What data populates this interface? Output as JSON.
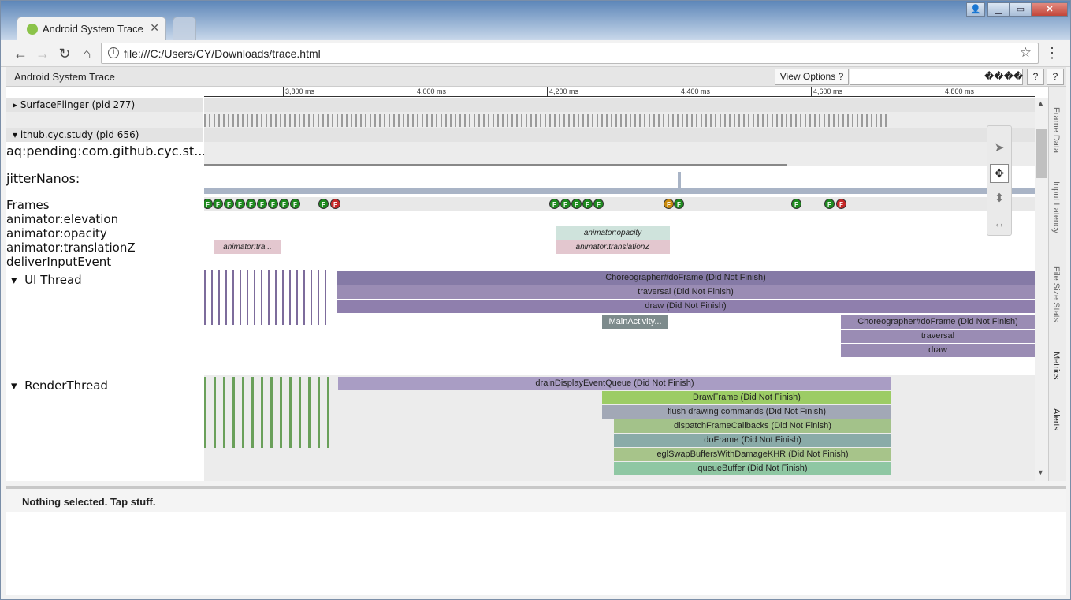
{
  "browser": {
    "tab_title": "Android System Trace",
    "url": "file:///C:/Users/CY/Downloads/trace.html"
  },
  "toolbar": {
    "title": "Android System Trace",
    "view_options": "View Options ?",
    "search_buttons": "����",
    "help_1": "?",
    "help_2": "?"
  },
  "ruler": {
    "ticks": [
      "3,800 ms",
      "4,000 ms",
      "4,200 ms",
      "4,400 ms",
      "4,600 ms",
      "4,800 ms"
    ]
  },
  "processes": {
    "surfaceflinger": "SurfaceFlinger (pid 277)",
    "app": "ithub.cyc.study (pid 656)"
  },
  "tracks": {
    "aq_pending": "aq:pending:com.github.cyc.st...",
    "jitter": "jitterNanos:",
    "frames": "Frames",
    "elevation": "animator:elevation",
    "opacity": "animator:opacity",
    "translationZ": "animator:translationZ",
    "input": "deliverInputEvent",
    "ui_thread": "UI Thread",
    "render_thread": "RenderThread"
  },
  "slices": {
    "anim_opacity": "animator:opacity",
    "anim_tra": "animator:tra...",
    "anim_translationZ": "animator:translationZ",
    "choreo": "Choreographer#doFrame (Did Not Finish)",
    "traversal": "traversal (Did Not Finish)",
    "draw": "draw (Did Not Finish)",
    "mainactivity": "MainActivity...",
    "choreo2": "Choreographer#doFrame (Did Not Finish)",
    "traversal2": "traversal",
    "draw2": "draw",
    "drain": "drainDisplayEventQueue (Did Not Finish)",
    "drawframe": "DrawFrame (Did Not Finish)",
    "flush": "flush drawing commands (Did Not Finish)",
    "dispatch": "dispatchFrameCallbacks (Did Not Finish)",
    "doframe": "doFrame (Did Not Finish)",
    "eglswap": "eglSwapBuffersWithDamageKHR (Did Not Finish)",
    "queuebuffer": "queueBuffer (Did Not Finish)"
  },
  "frame_markers": {
    "label": "F"
  },
  "sidebar_tabs": [
    "Frame Data",
    "Input Latency",
    "File Size Stats",
    "Metrics",
    "Alerts"
  ],
  "detail": {
    "message": "Nothing selected. Tap stuff."
  },
  "colors": {
    "purple": "#7d6c9c",
    "green": "#8bc34a",
    "teal": "#5e8f7a",
    "frame_green": "#1e8a1e",
    "frame_red": "#c62828",
    "frame_orange": "#c98a0b"
  }
}
